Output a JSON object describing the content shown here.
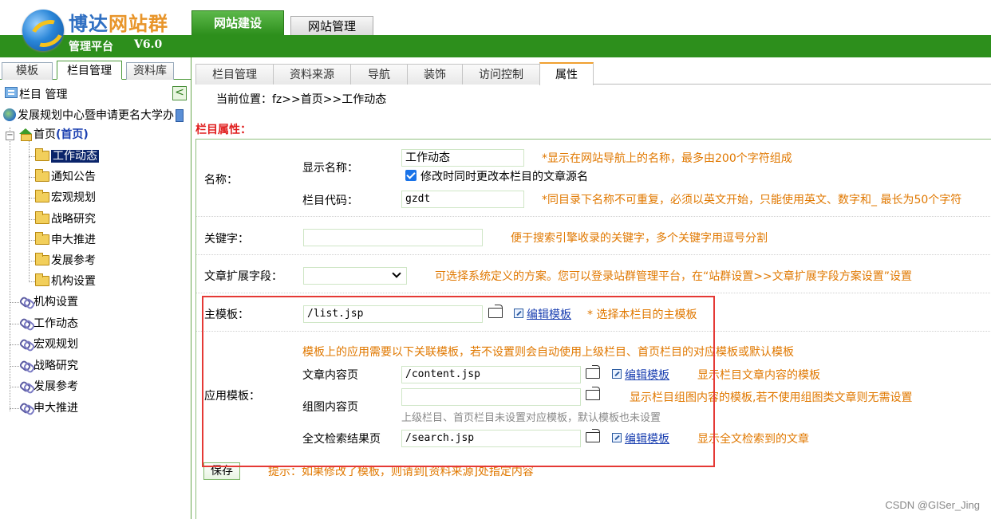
{
  "header": {
    "logo_title_main": "博达",
    "logo_title_accent": "网站群",
    "logo_subtitle": "管理平台",
    "logo_version": "V6.0",
    "top_tabs": [
      "网站建设",
      "网站管理"
    ]
  },
  "left": {
    "tabs": [
      "模板",
      "栏目管理",
      "资料库"
    ],
    "head_label": "栏目 管理",
    "collapse_glyph": "<",
    "tree": {
      "root": "发展规划中心暨申请更名大学办",
      "home": "首页",
      "home_tag": "(首页)",
      "home_children": [
        "工作动态",
        "通知公告",
        "宏观规划",
        "战略研究",
        "申大推进",
        "发展参考",
        "机构设置"
      ],
      "links": [
        "机构设置",
        "工作动态",
        "宏观规划",
        "战略研究",
        "发展参考",
        "申大推进"
      ]
    }
  },
  "main": {
    "tabs": [
      "栏目管理",
      "资料来源",
      "导航",
      "装饰",
      "访问控制",
      "属性"
    ],
    "active_tab": "属性",
    "breadcrumb": "当前位置：fz>>首页>>工作动态",
    "section_title": "栏目属性：",
    "name": {
      "label": "名称：",
      "display_name_label": "显示名称：",
      "display_name_value": "工作动态",
      "display_name_hint": "*显示在网站导航上的名称，最多由200个字符组成",
      "sync_checkbox_label": "修改时同时更改本栏目的文章源名",
      "sync_checked": true,
      "code_label": "栏目代码：",
      "code_value": "gzdt",
      "code_hint": "*同目录下名称不可重复，必须以英文开始，只能使用英文、数字和_ 最长为50个字符"
    },
    "keyword": {
      "label": "关键字：",
      "value": "",
      "hint": "便于搜索引擎收录的关键字，多个关键字用逗号分割"
    },
    "ext_field": {
      "label": "文章扩展字段：",
      "value": "",
      "hint": "可选择系统定义的方案。您可以登录站群管理平台，在“站群设置>>文章扩展字段方案设置”设置"
    },
    "main_template": {
      "label": "主模板：",
      "value": "/list.jsp",
      "edit_link": "编辑模板",
      "hint": "*  选择本栏目的主模板"
    },
    "app_template": {
      "label": "应用模板：",
      "intro_hint": "模板上的应用需要以下关联模板，若不设置则会自动使用上级栏目、首页栏目的对应模板或默认模板",
      "article": {
        "label": "文章内容页",
        "value": "/content.jsp",
        "edit_link": "编辑模板",
        "hint": "显示栏目文章内容的模板"
      },
      "gallery": {
        "label": "组图内容页",
        "value": "",
        "hint": "显示栏目组图内容的模板,若不使用组图类文章则无需设置",
        "note": "上级栏目、首页栏目未设置对应模板，默认模板也未设置"
      },
      "search": {
        "label": "全文检索结果页",
        "value": "/search.jsp",
        "edit_link": "编辑模板",
        "hint": "显示全文检索到的文章"
      }
    },
    "save_label": "保存",
    "save_hint": "提示：如果修改了模板，则请到[资料来源]处指定内容"
  },
  "watermark": "CSDN @GISer_Jing",
  "colors": {
    "brand_green": "#2d8f1c",
    "hint_orange": "#e07800",
    "section_red": "#e02020",
    "highlight_box": "#e53935"
  }
}
